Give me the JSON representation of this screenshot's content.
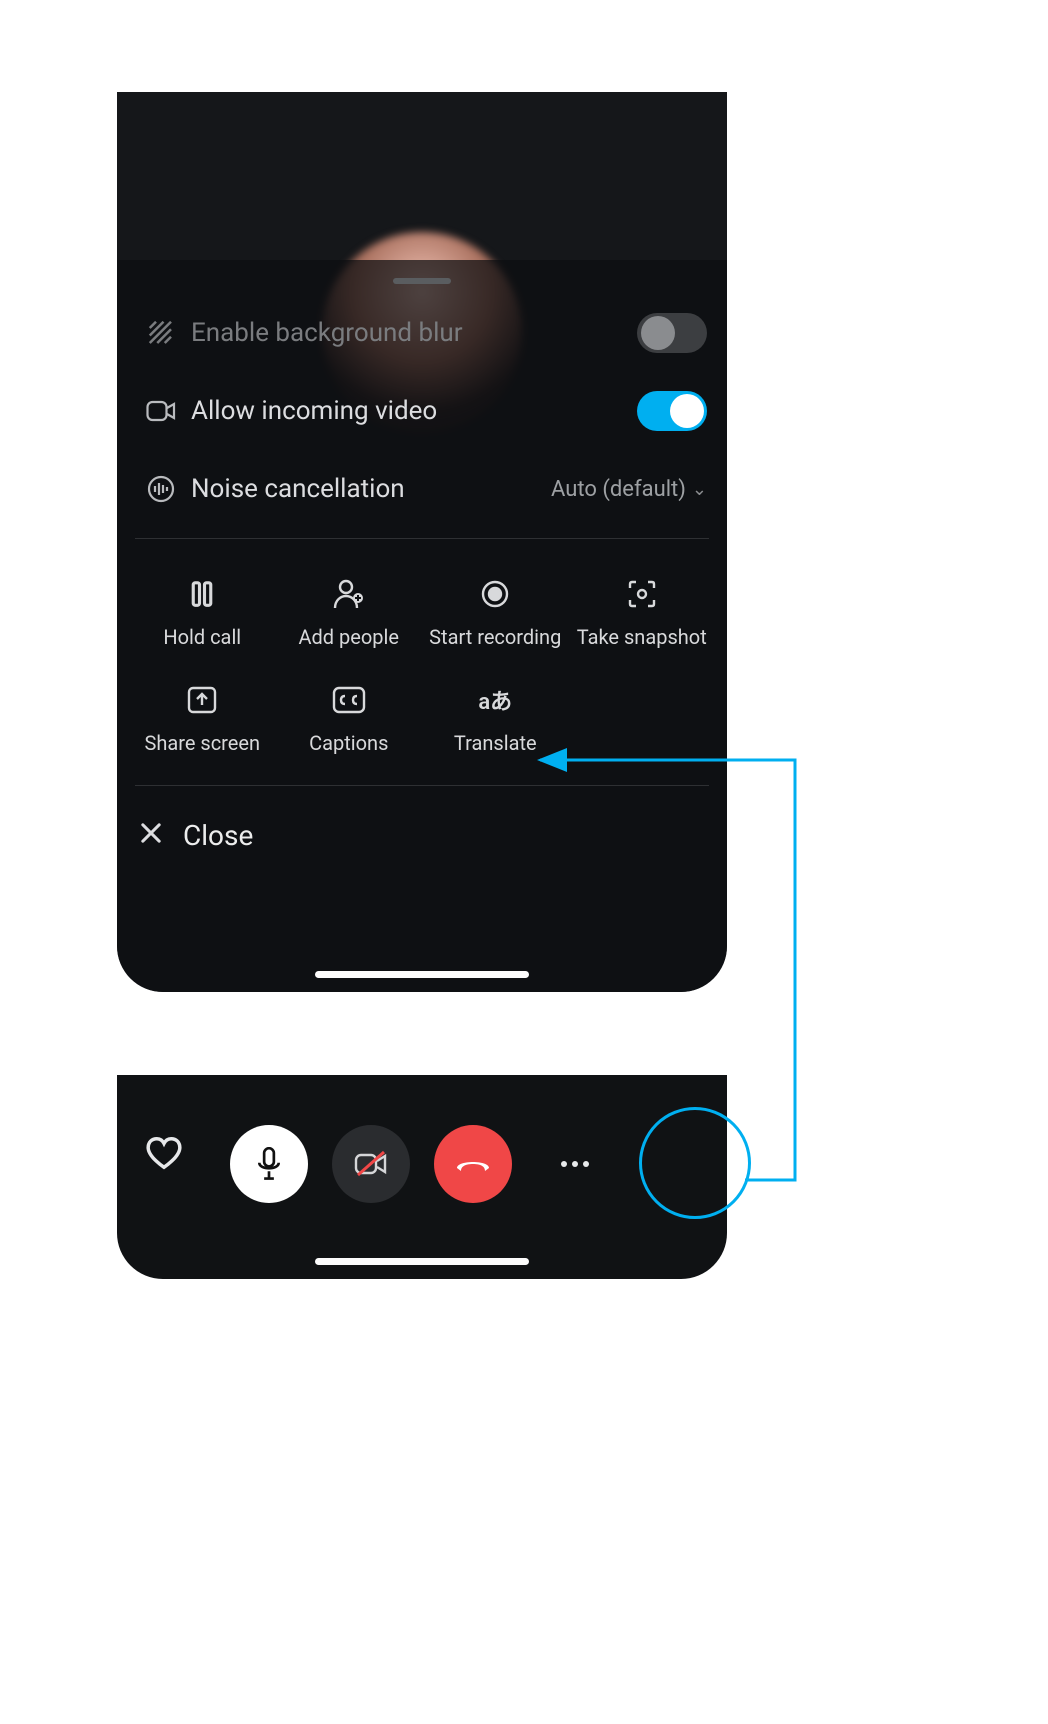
{
  "settings": {
    "blur_label": "Enable background blur",
    "blur_enabled": false,
    "incoming_label": "Allow incoming video",
    "incoming_enabled": true,
    "noise_label": "Noise cancellation",
    "noise_value": "Auto (default)"
  },
  "actions": {
    "hold": "Hold call",
    "add_people": "Add people",
    "start_recording": "Start recording",
    "take_snapshot": "Take snapshot",
    "share_screen": "Share screen",
    "captions": "Captions",
    "translate": "Translate"
  },
  "close_label": "Close",
  "colors": {
    "accent": "#00aff0",
    "hangup": "#f04747",
    "bg": "#101214"
  }
}
